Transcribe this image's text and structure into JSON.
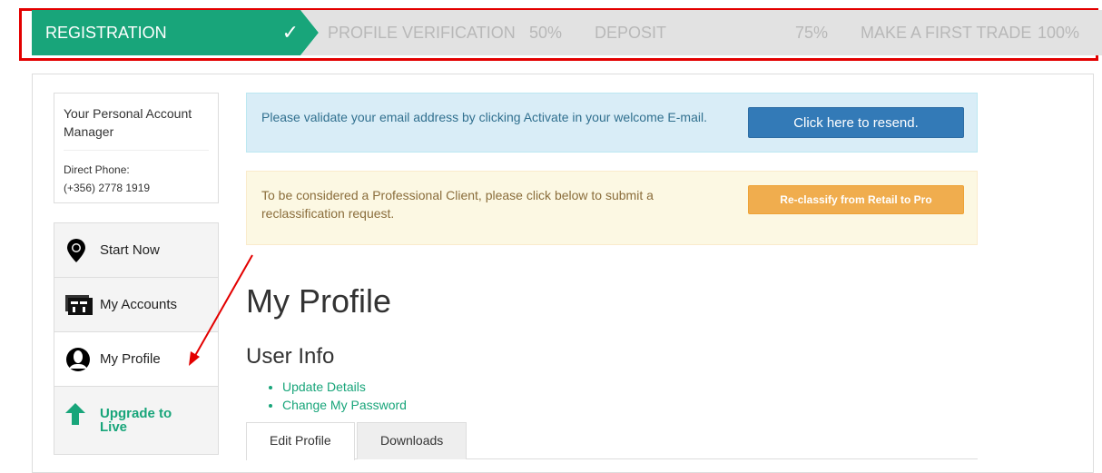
{
  "progress": {
    "steps": [
      {
        "label": "REGISTRATION",
        "status": "✓",
        "complete": true
      },
      {
        "label": "PROFILE VERIFICATION",
        "status": "50%"
      },
      {
        "label": "DEPOSIT",
        "status": "75%"
      },
      {
        "label": "MAKE A FIRST TRADE",
        "status": "100%"
      }
    ],
    "accent": "#18a57a"
  },
  "manager": {
    "title": "Your Personal Account Manager",
    "phone_label": "Direct Phone:",
    "phone": "(+356) 2778 1919"
  },
  "sidebar": {
    "items": [
      {
        "label": "Start Now",
        "icon": "map-pin-icon"
      },
      {
        "label": "My Accounts",
        "icon": "accounts-icon"
      },
      {
        "label": "My Profile",
        "icon": "user-icon",
        "active": true
      },
      {
        "label": "Upgrade to Live",
        "icon": "arrow-up-icon"
      }
    ]
  },
  "alerts": {
    "email": {
      "text": "Please validate your email address by clicking Activate in your welcome E-mail.",
      "button": "Click here to resend."
    },
    "pro": {
      "text": "To be considered a Professional Client, please click below to submit a reclassification request.",
      "button": "Re-classify from Retail to Pro"
    }
  },
  "main": {
    "title": "My Profile",
    "section": "User Info",
    "links": [
      "Update Details",
      "Change My Password"
    ],
    "tabs": [
      "Edit Profile",
      "Downloads"
    ]
  }
}
